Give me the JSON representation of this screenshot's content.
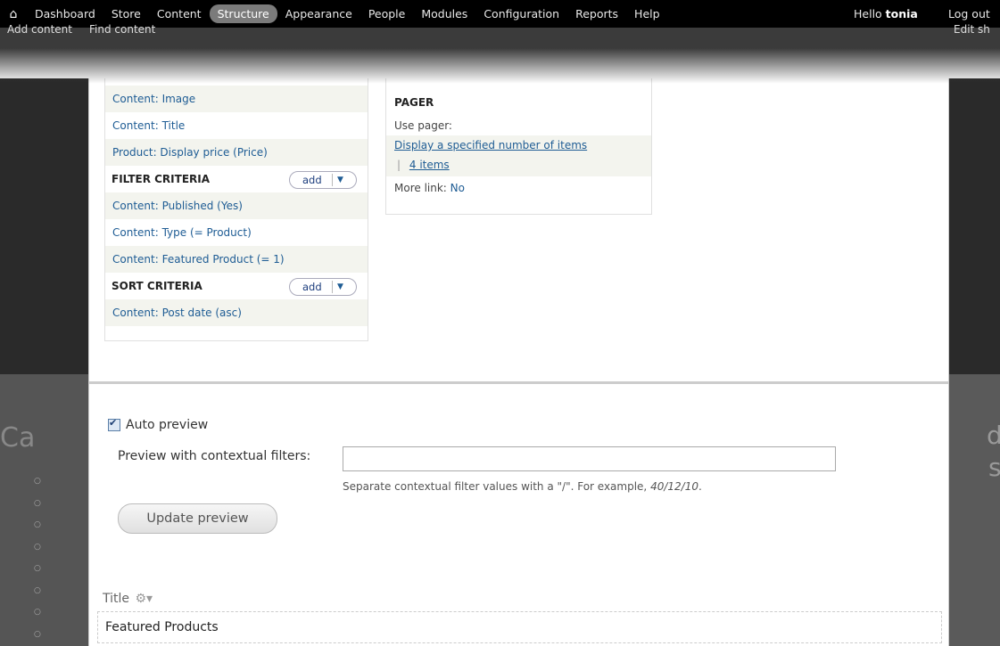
{
  "toolbar": {
    "menu": [
      "Dashboard",
      "Store",
      "Content",
      "Structure",
      "Appearance",
      "People",
      "Modules",
      "Configuration",
      "Reports",
      "Help"
    ],
    "active": "Structure",
    "hello": "Hello",
    "user": "tonia",
    "logout": "Log out",
    "shortcuts": [
      "Add content",
      "Find content"
    ],
    "edit_shortcuts": "Edit sh"
  },
  "fields": {
    "rows": [
      "Content: Image",
      "Content: Title",
      "Product: Display price (Price)"
    ]
  },
  "filter": {
    "heading": "FILTER CRITERIA",
    "add_label": "add",
    "rows": [
      "Content: Published (Yes)",
      "Content: Type (= Product)",
      "Content: Featured Product (= 1)"
    ]
  },
  "sort": {
    "heading": "SORT CRITERIA",
    "add_label": "add",
    "rows": [
      "Content: Post date (asc)"
    ]
  },
  "pager": {
    "heading": "PAGER",
    "use_pager_label": "Use pager:",
    "use_pager_value": "Display a specified number of items",
    "separator": "|",
    "items": "4 items",
    "more_link_label": "More link:",
    "more_link_value": "No"
  },
  "preview": {
    "auto_preview_label": "Auto preview",
    "auto_preview_checked": true,
    "ctx_label": "Preview with contextual filters:",
    "ctx_value": "",
    "ctx_desc": "Separate contextual filter values with a \"/\". For example,",
    "ctx_example": "40/12/10",
    "update_label": "Update preview"
  },
  "result": {
    "title_label": "Title",
    "featured": "Featured Products"
  },
  "background": {
    "left_text": "Ca",
    "right_text_1": "d",
    "right_text_2": "s"
  },
  "colors": {
    "link": "#1e5c94",
    "toolbar": "#000000",
    "active_tab": "#7b7b7b"
  }
}
